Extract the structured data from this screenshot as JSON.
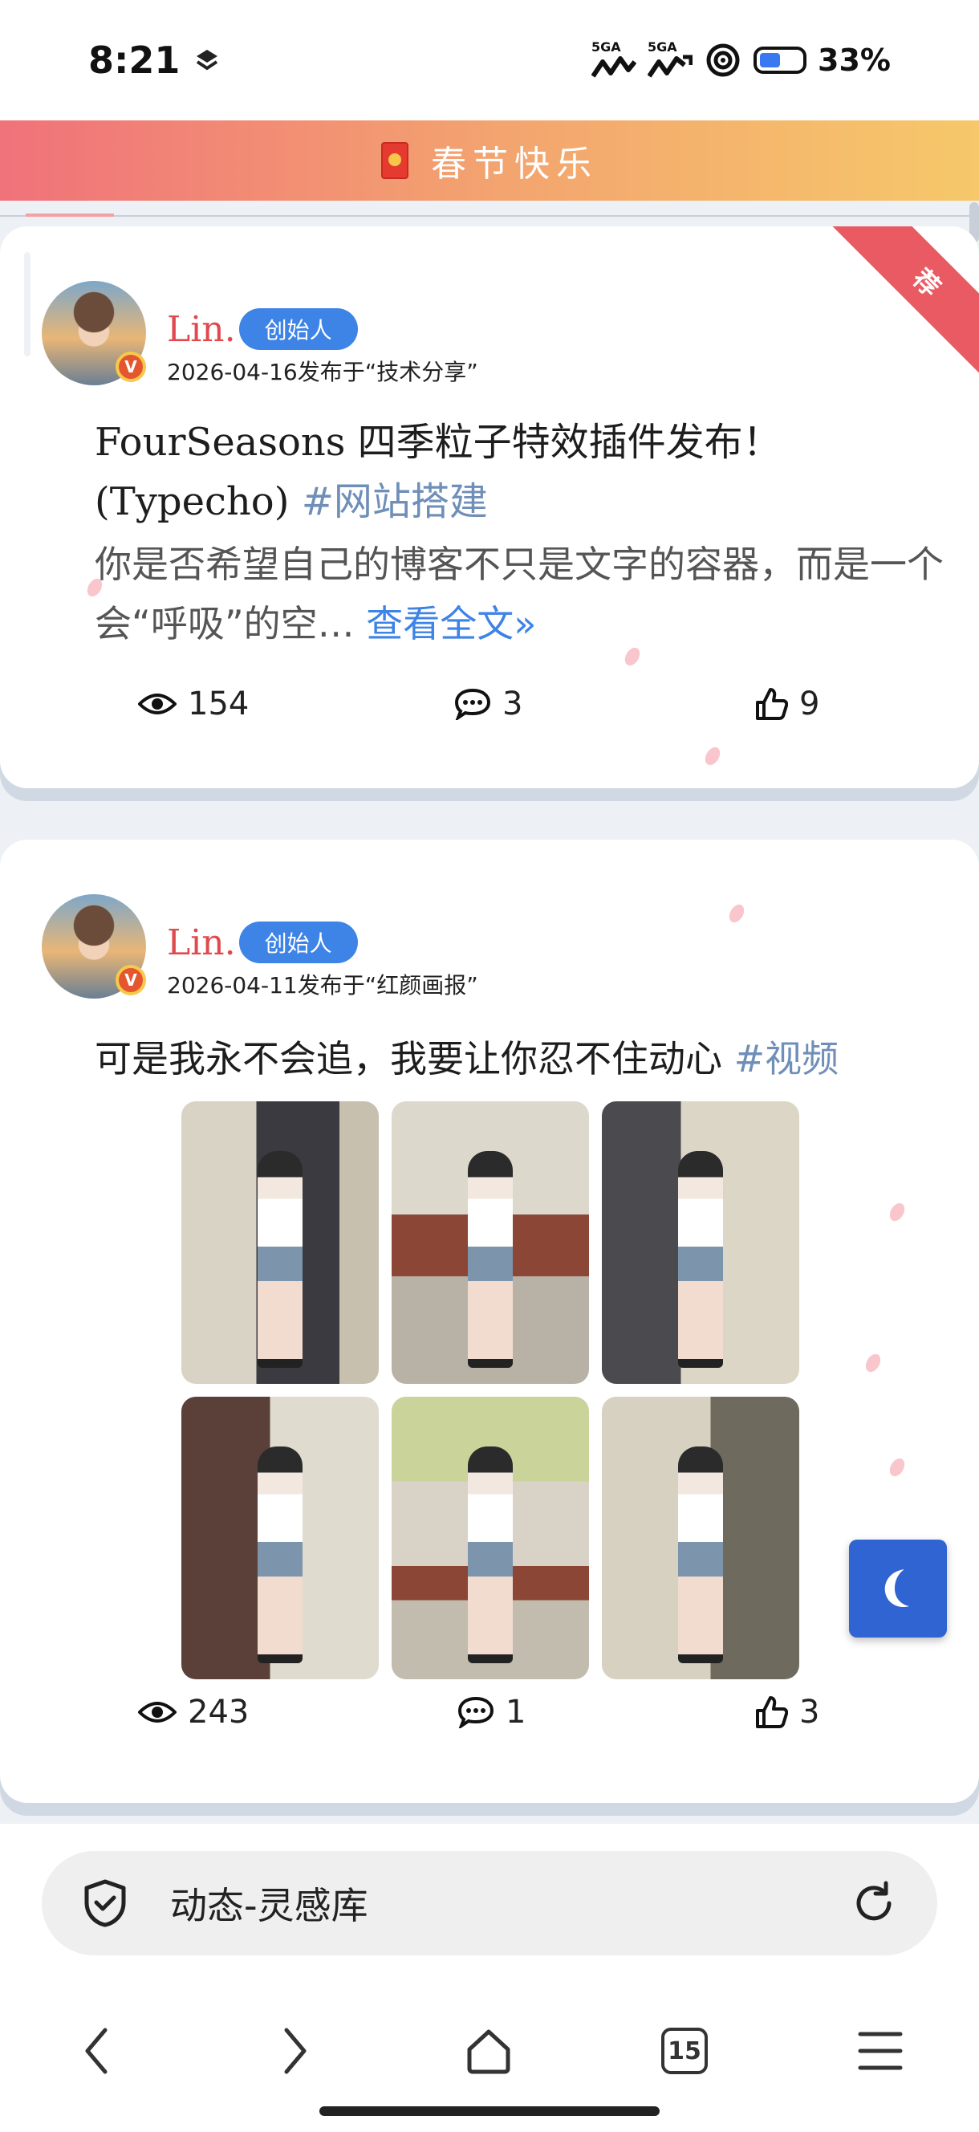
{
  "status_bar": {
    "time": "8:21",
    "sim1_label": "5GA",
    "sim2_label": "5GA",
    "battery_percent": "33%",
    "battery_level": 0.33
  },
  "banner": {
    "text": "春节快乐",
    "icon": "red-envelope-icon"
  },
  "posts": [
    {
      "recommended_label": "荐",
      "author": {
        "name": "Lin.",
        "role": "创始人",
        "verified_badge": "V"
      },
      "meta": "2026-04-16发布于“技术分享”",
      "title": "FourSeasons 四季粒子特效插件发布！(Typecho)",
      "tag": "#网站搭建",
      "excerpt": "你是否希望自己的博客不只是文字的容器，而是一个会“呼吸”的空…",
      "read_more": "查看全文»",
      "stats": {
        "views": "154",
        "comments": "3",
        "likes": "9"
      }
    },
    {
      "author": {
        "name": "Lin.",
        "role": "创始人",
        "verified_badge": "V"
      },
      "meta": "2026-04-11发布于“红颜画报”",
      "title": "可是我永不会追，我要让你忍不住动心",
      "tag": "#视频",
      "image_count": 6,
      "stats": {
        "views": "243",
        "comments": "1",
        "likes": "3"
      }
    }
  ],
  "floating_button": {
    "icon": "moon-icon"
  },
  "browser": {
    "address_text": "动态-灵感库",
    "tab_count": "15"
  },
  "colors": {
    "accent_blue": "#3e83e6",
    "author_red": "#e0494e",
    "tag_blue": "#6f8fb8",
    "banner_start": "#f0727a",
    "banner_end": "#f6c86a",
    "ribbon_red": "#e95a62"
  }
}
